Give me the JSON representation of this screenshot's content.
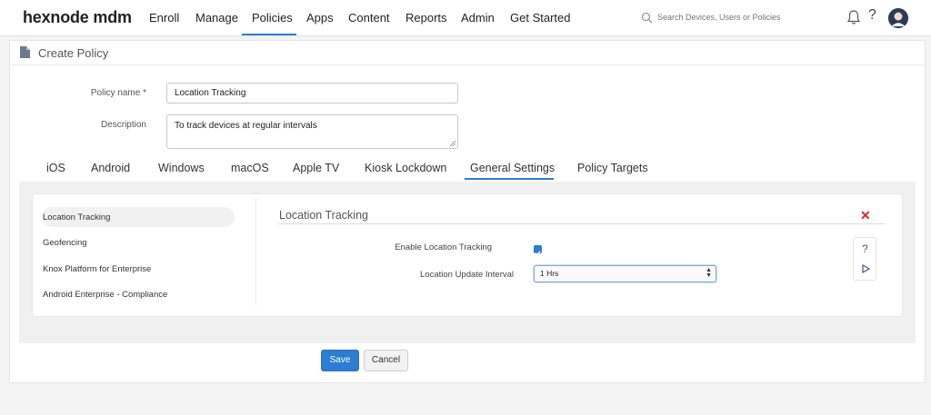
{
  "brand": {
    "logo_text": "hexnode mdm",
    "accent": "#2d7dd2"
  },
  "nav": {
    "items": [
      "Enroll",
      "Manage",
      "Policies",
      "Apps",
      "Content",
      "Reports",
      "Admin",
      "Get Started"
    ],
    "active": "Policies",
    "search_placeholder": "Search Devices, Users or Policies",
    "help_label": "?"
  },
  "page": {
    "title": "Create Policy"
  },
  "form": {
    "policy_name_label": "Policy name *",
    "policy_name_value": "Location Tracking",
    "description_label": "Description",
    "description_value": "To track devices at regular intervals"
  },
  "tabs": {
    "items": [
      "iOS",
      "Android",
      "Windows",
      "macOS",
      "Apple TV",
      "Kiosk Lockdown",
      "General Settings",
      "Policy Targets"
    ],
    "active": "General Settings"
  },
  "sidebar": {
    "items": [
      "Location Tracking",
      "Geofencing",
      "Knox Platform for Enterprise",
      "Android Enterprise - Compliance"
    ],
    "active": "Location Tracking"
  },
  "section": {
    "title": "Location Tracking",
    "close_glyph": "✕",
    "enable_label": "Enable Location Tracking",
    "enable_checked": true,
    "interval_label": "Location Update Interval",
    "interval_value": "1 Hrs",
    "help_glyph": "?"
  },
  "actions": {
    "save_label": "Save",
    "cancel_label": "Cancel"
  }
}
